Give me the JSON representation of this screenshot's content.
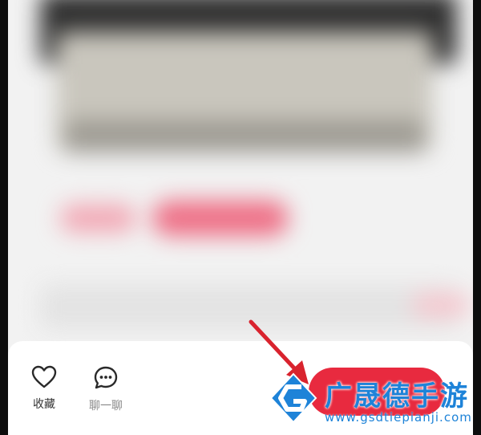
{
  "bottom_bar": {
    "favorite": {
      "label": "收藏",
      "icon": "heart-icon"
    },
    "chat": {
      "label": "聊一聊",
      "icon": "chat-bubble-icon"
    },
    "primary_color": "#e82a3f"
  },
  "annotation": {
    "arrow_color": "#d9232e"
  },
  "watermark": {
    "title": "广晟德手游",
    "url": "www.gsdtiepianji.com",
    "color": "#1e83d8"
  }
}
